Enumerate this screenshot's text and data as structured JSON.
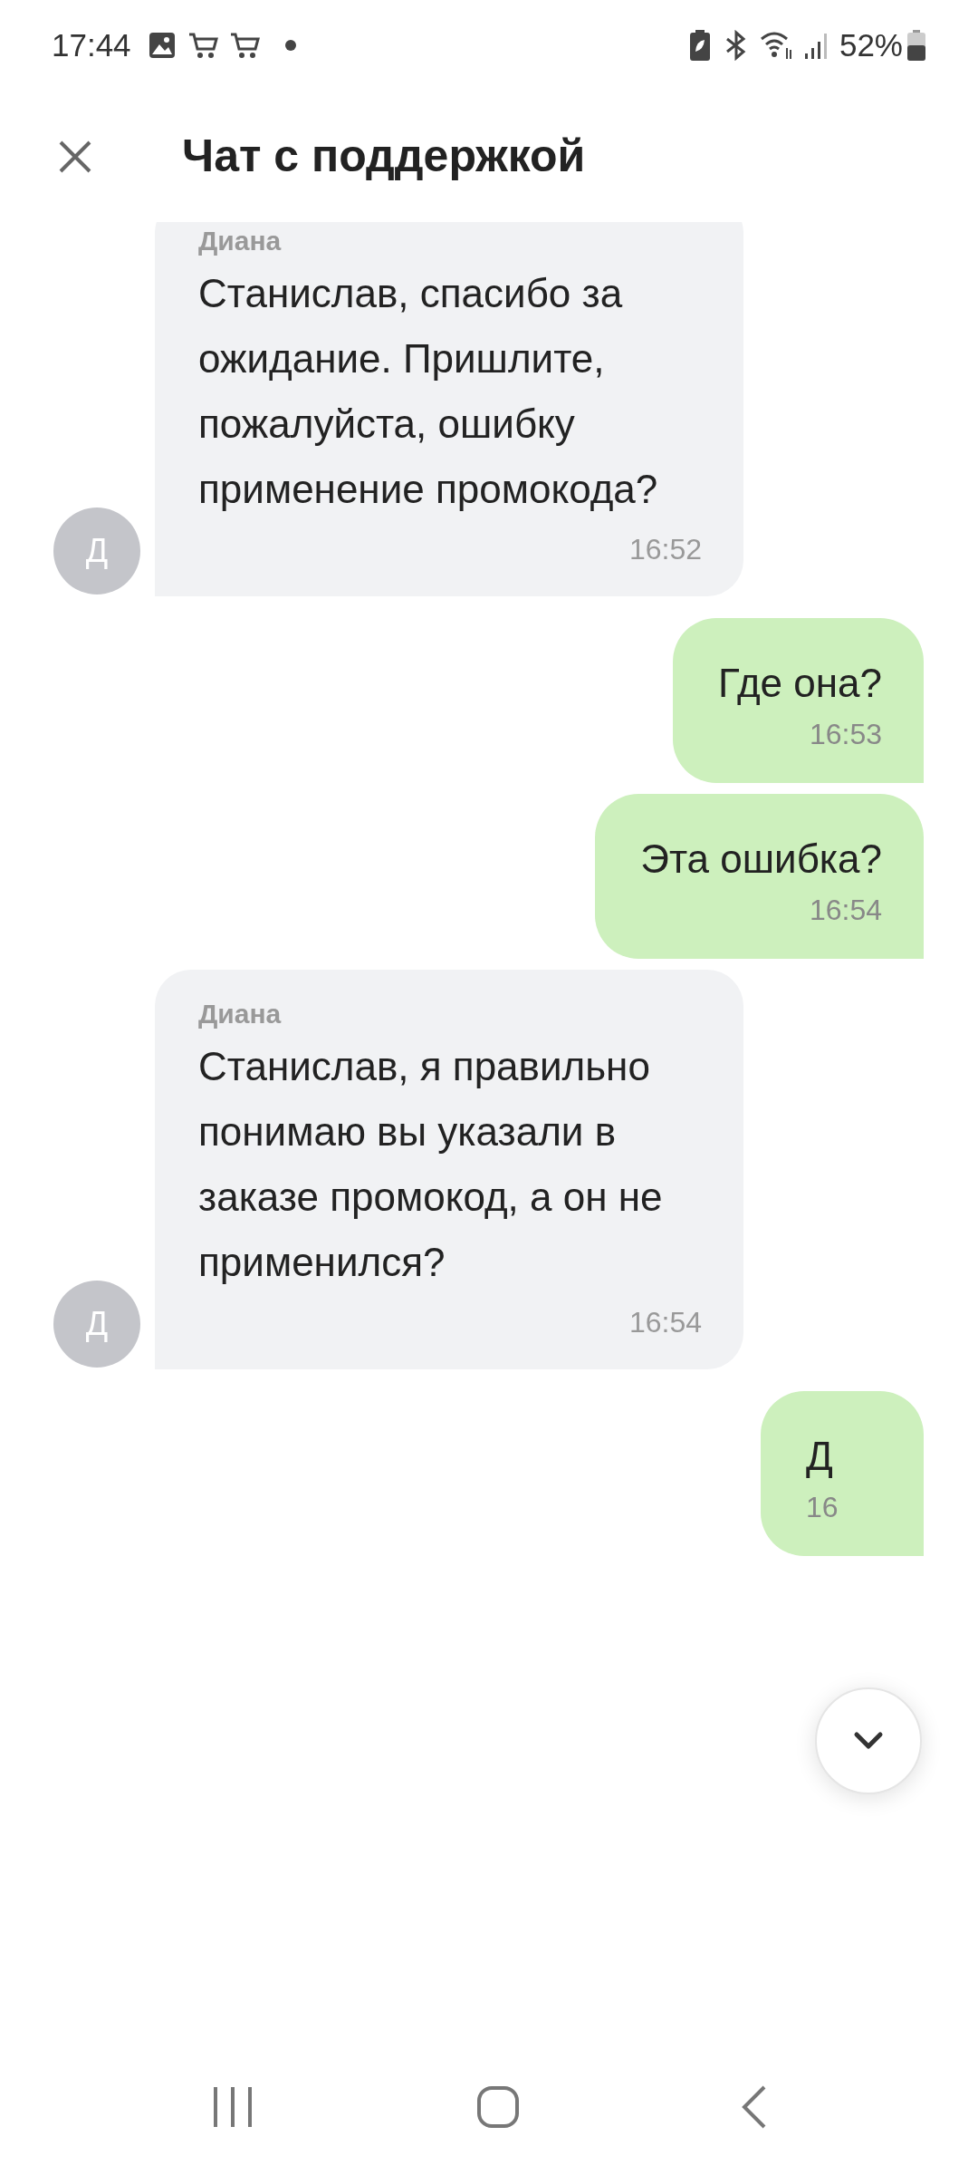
{
  "status_bar": {
    "time": "17:44",
    "battery": "52%"
  },
  "header": {
    "title": "Чат с поддержкой"
  },
  "messages": [
    {
      "kind": "incoming",
      "avatar": "Д",
      "sender": "Диана",
      "text": "Станислав, спасибо за ожидание. Пришлите, пожалуйста, ошибку применение промокода?",
      "time": "16:52"
    },
    {
      "kind": "outgoing",
      "text": "Где она?",
      "time": "16:53"
    },
    {
      "kind": "outgoing",
      "text": "Эта ошибка?",
      "time": "16:54"
    },
    {
      "kind": "incoming",
      "avatar": "Д",
      "sender": "Диана",
      "text": "Станислав, я правильно понимаю вы указали в заказе промокод, а он не применился?",
      "time": "16:54"
    },
    {
      "kind": "outgoing",
      "text": "Д",
      "time": "16"
    }
  ]
}
